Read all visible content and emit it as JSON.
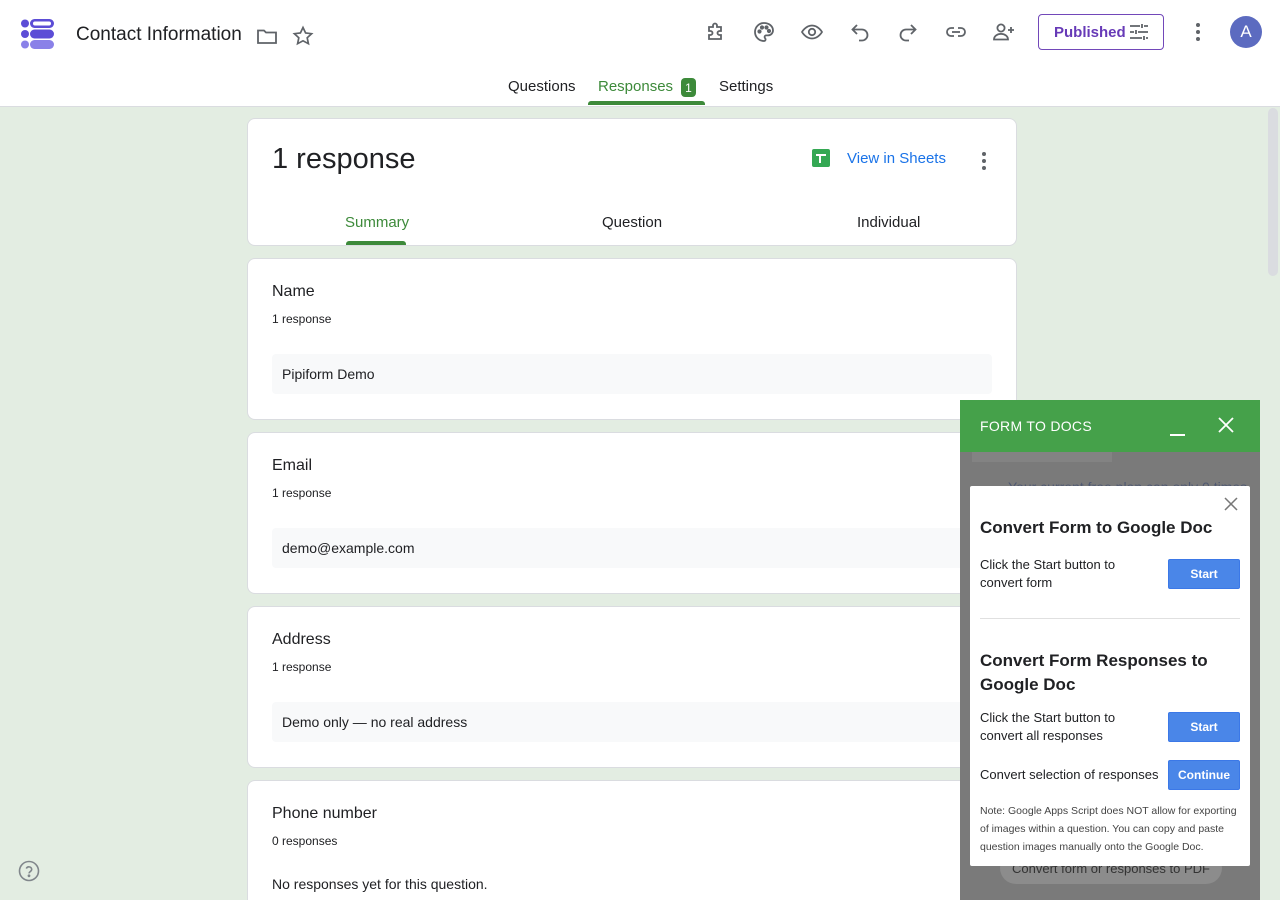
{
  "header": {
    "form_title": "Contact Information",
    "publish_label": "Published",
    "avatar_initial": "A"
  },
  "main_tabs": {
    "questions": "Questions",
    "responses": "Responses",
    "responses_badge": "1",
    "settings": "Settings"
  },
  "summary": {
    "count_title": "1 response",
    "sheets_label": "View in Sheets",
    "tabs": [
      "Summary",
      "Question",
      "Individual"
    ]
  },
  "questions": [
    {
      "title": "Name",
      "count": "1 response",
      "answer": "Pipiform Demo"
    },
    {
      "title": "Email",
      "count": "1 response",
      "answer": "demo@example.com"
    },
    {
      "title": "Address",
      "count": "1 response",
      "answer": "Demo only — no real address"
    },
    {
      "title": "Phone number",
      "count": "0 responses",
      "empty": "No responses yet for this question."
    }
  ],
  "addon": {
    "title": "FORM TO DOCS",
    "background_notice": "Your current free plan can only 0 times",
    "background_button": "Convert form or responses to PDF",
    "dialog": {
      "heading1": "Convert Form to Google Doc",
      "text1": "Click the Start button to convert form",
      "start1": "Start",
      "heading2": "Convert Form Responses to Google Doc",
      "text2": "Click the Start button to convert all responses",
      "start2": "Start",
      "text3": "Convert selection of responses",
      "continue": "Continue",
      "note": "Note: Google Apps Script does NOT allow for exporting of images within a question. You can copy and paste question images manually onto the Google Doc."
    }
  },
  "colors": {
    "accent_green": "#3d8a3a",
    "publish_purple": "#673ab7",
    "addon_green": "#45a14a",
    "dialog_button_blue": "#4a86e8",
    "page_background": "#e3ede2"
  }
}
